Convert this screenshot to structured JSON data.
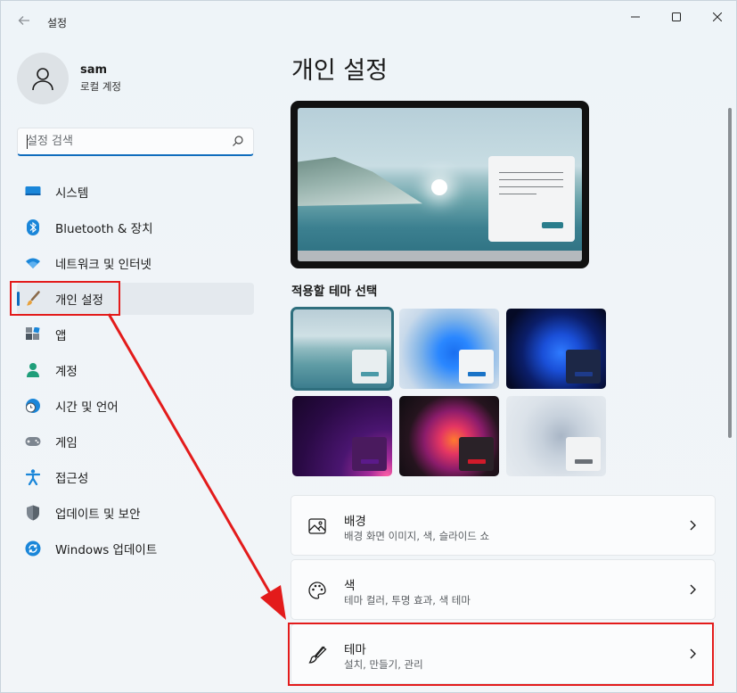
{
  "window": {
    "title": "설정"
  },
  "profile": {
    "name": "sam",
    "account_type": "로컬 계정"
  },
  "search": {
    "placeholder": "설정 검색"
  },
  "sidebar": {
    "items": [
      {
        "label": "시스템",
        "icon": "system-icon"
      },
      {
        "label": "Bluetooth & 장치",
        "icon": "bluetooth-icon"
      },
      {
        "label": "네트워크 및 인터넷",
        "icon": "wifi-icon"
      },
      {
        "label": "개인 설정",
        "icon": "brush-icon",
        "active": true
      },
      {
        "label": "앱",
        "icon": "apps-icon"
      },
      {
        "label": "계정",
        "icon": "person-icon"
      },
      {
        "label": "시간 및 언어",
        "icon": "globe-clock-icon"
      },
      {
        "label": "게임",
        "icon": "gamepad-icon"
      },
      {
        "label": "접근성",
        "icon": "accessibility-icon"
      },
      {
        "label": "업데이트 및 보안",
        "icon": "shield-icon"
      },
      {
        "label": "Windows 업데이트",
        "icon": "update-icon"
      }
    ]
  },
  "main": {
    "title": "개인 설정",
    "theme_heading": "적용할 테마 선택",
    "themes": [
      {
        "name": "glow-lake",
        "selected": true,
        "accent": "#4a9aa8"
      },
      {
        "name": "bloom-light",
        "selected": false,
        "accent": "#1a73c7"
      },
      {
        "name": "bloom-dark",
        "selected": false,
        "accent": "#1e3b8a"
      },
      {
        "name": "captured-motion",
        "selected": false,
        "accent": "#5b1a8a"
      },
      {
        "name": "flow",
        "selected": false,
        "accent": "#d11a2a"
      },
      {
        "name": "sunrise",
        "selected": false,
        "accent": "#6a6f75"
      }
    ],
    "cards": [
      {
        "title": "배경",
        "description": "배경 화면 이미지, 색, 슬라이드 쇼",
        "icon": "image-icon"
      },
      {
        "title": "색",
        "description": "테마 컬러, 투명 효과, 색 테마",
        "icon": "palette-icon"
      },
      {
        "title": "테마",
        "description": "설치, 만들기, 관리",
        "icon": "brush-icon"
      }
    ]
  },
  "colors": {
    "accent": "#0f6cbd",
    "annotation": "#e31b1b"
  }
}
